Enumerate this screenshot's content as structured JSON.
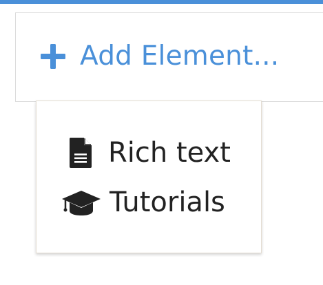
{
  "colors": {
    "accent": "#4a90d9",
    "text": "#222222"
  },
  "add_element": {
    "label": "Add Element...",
    "icon": "plus-icon"
  },
  "menu": {
    "items": [
      {
        "label": "Rich text",
        "icon": "file-text-icon"
      },
      {
        "label": "Tutorials",
        "icon": "graduation-cap-icon"
      }
    ]
  }
}
